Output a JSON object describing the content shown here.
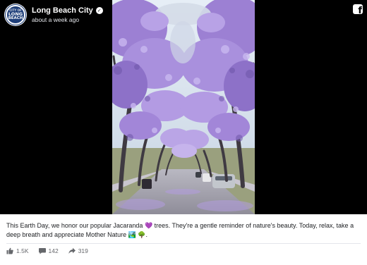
{
  "post": {
    "page_name": "Long Beach City",
    "verified_icon": "verified-check-icon",
    "timestamp": "about a week ago",
    "avatar": {
      "line1": "CITY OF",
      "line2": "LONG",
      "line3": "BEACH",
      "color": "#1f3f7a"
    },
    "platform_icon": "facebook-logo-icon",
    "caption": "This Earth Day, we honor our popular Jacaranda 💜 trees. They're a gentle reminder of nature's beauty. Today, relax, take a deep breath and appreciate Mother Nature 🏞️ 🌳."
  },
  "stats": {
    "likes": "1.5K",
    "comments": "142",
    "shares": "319",
    "like_icon": "thumbs-up-icon",
    "comment_icon": "comment-bubble-icon",
    "share_icon": "share-arrow-icon"
  },
  "photo": {
    "subject": "street-lined-with-jacaranda-trees",
    "colors": {
      "blossom": "#a58bd9",
      "blossom_dark": "#7e63bd",
      "sky": "#d9e4ef",
      "road": "#a8a8b0",
      "trunk": "#3f3a42"
    }
  }
}
